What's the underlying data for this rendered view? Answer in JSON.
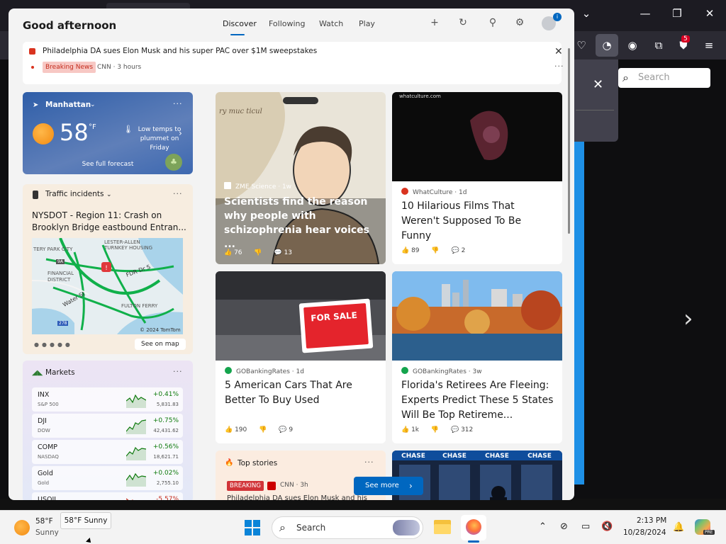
{
  "panel": {
    "greeting": "Good afternoon",
    "tabs": [
      {
        "label": "Discover"
      },
      {
        "label": "Following"
      },
      {
        "label": "Watch"
      },
      {
        "label": "Play"
      }
    ],
    "profile_badge": "i"
  },
  "breaking_banner": {
    "headline": "Philadelphia DA sues Elon Musk and his super PAC over $1M sweepstakes",
    "tag": "Breaking News",
    "source": "CNN · 3 hours"
  },
  "weather": {
    "location": "Manhattan",
    "temperature": "58",
    "unit": "°F",
    "alert": "Low temps to plummet on Friday",
    "forecast_link": "See full forecast"
  },
  "traffic": {
    "title": "Traffic incidents",
    "headline": "NYSDOT - Region 11: Crash on Brooklyn Bridge eastbound Entran...",
    "map_labels": {
      "area1": "TERY PARK CITY",
      "area2": "LESTER-ALLEN TURNKEY HOUSING",
      "area3": "FINANCIAL DISTRICT",
      "street1": "FDR Dr S",
      "street2": "Water St",
      "area4": "FULTON FERRY",
      "route": "9A",
      "route2": "278",
      "copyright": "© 2024 TomTom"
    },
    "see_on_map": "See on map"
  },
  "markets": {
    "title": "Markets",
    "items": [
      {
        "symbol": "INX",
        "name": "S&P 500",
        "change": "+0.41%",
        "price": "5,831.83",
        "negative": false
      },
      {
        "symbol": "DJI",
        "name": "DOW",
        "change": "+0.75%",
        "price": "42,431.62",
        "negative": false
      },
      {
        "symbol": "COMP",
        "name": "NASDAQ",
        "change": "+0.56%",
        "price": "18,621.71",
        "negative": false
      },
      {
        "symbol": "Gold",
        "name": "Gold",
        "change": "+0.02%",
        "price": "2,755.10",
        "negative": false
      },
      {
        "symbol": "USOIL",
        "name": "",
        "change": "-5.57%",
        "price": "",
        "negative": true
      }
    ]
  },
  "news": [
    {
      "source": "ZME Science · 1w",
      "title": "Scientists find the reason why people with schizophrenia hear voices ...",
      "likes": "76",
      "comments": "13",
      "image_text": "ry muc ticul"
    },
    {
      "source": "WhatCulture · 1d",
      "title": "10 Hilarious Films That Weren't Supposed To Be Funny",
      "likes": "89",
      "comments": "2",
      "image_text": "whatculture.com"
    },
    {
      "source": "GOBankingRates · 1d",
      "title": "5 American Cars That Are Better To Buy Used",
      "likes": "190",
      "comments": "9",
      "image_text": "FOR SALE"
    },
    {
      "source": "GOBankingRates · 3w",
      "title": "Florida's Retirees Are Fleeing: Experts Predict These 5 States Will Be Top Retireme...",
      "likes": "1k",
      "comments": "312"
    }
  ],
  "top_stories": {
    "title": "Top stories",
    "tag": "BREAKING",
    "source": "CNN · 3h",
    "headline": "Philadelphia DA sues Elon Musk and his"
  },
  "chase": {
    "sign": "CHASE"
  },
  "see_more": "See more",
  "browser": {
    "search_placeholder": "Search",
    "extension_badge": "5"
  },
  "taskbar": {
    "weather_temp": "58°F",
    "weather_cond": "Sunny",
    "tooltip": "58°F Sunny",
    "search_label": "Search",
    "time": "2:13 PM",
    "date": "10/28/2024",
    "copilot_badge": "PRE"
  },
  "colors": {
    "accent": "#0067c0",
    "breaking": "#d13438",
    "positive": "#0e7a0d",
    "negative": "#c42b1c"
  }
}
